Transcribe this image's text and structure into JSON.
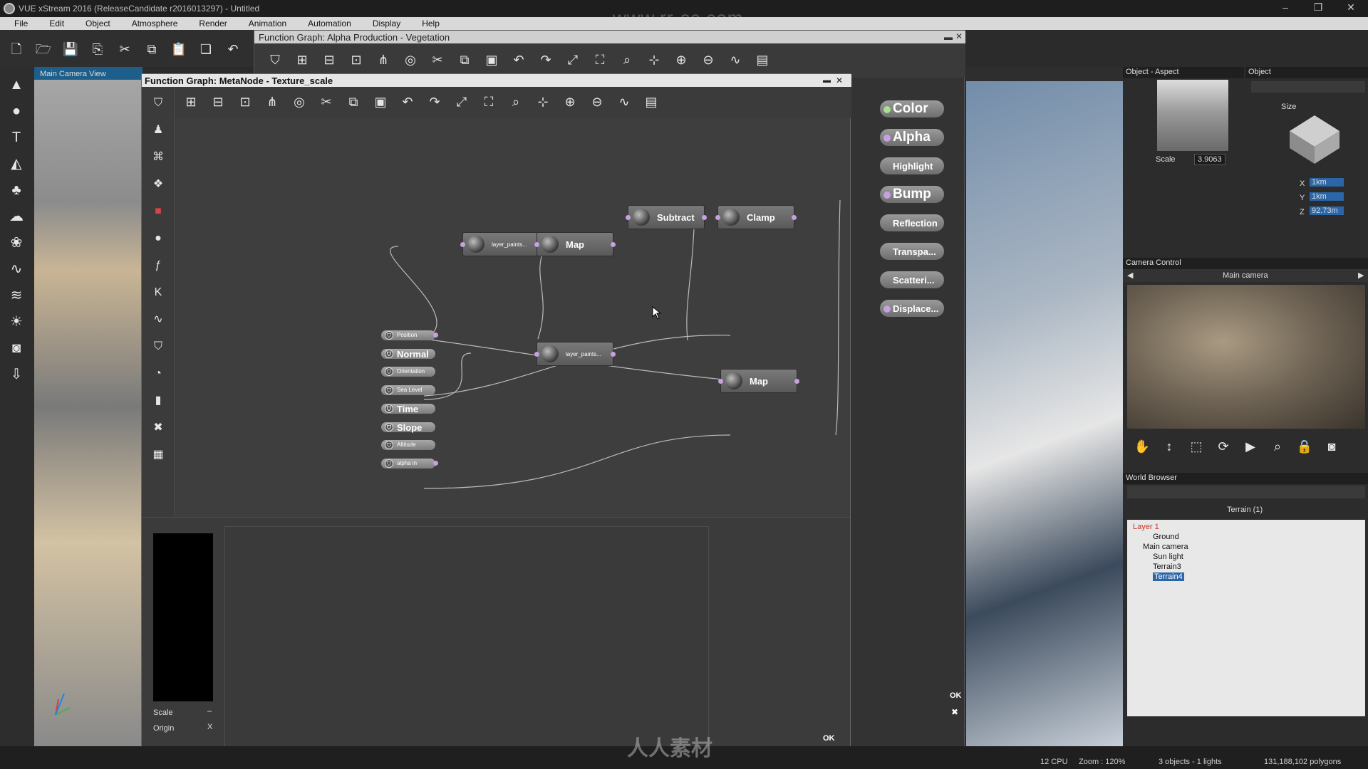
{
  "app": {
    "title": "VUE xStream 2016 (ReleaseCandidate r2016013297) - Untitled",
    "watermark_top": "www.rr-sc.com",
    "watermark_bottom": "人人素材",
    "window_buttons": [
      "–",
      "❐",
      "✕"
    ]
  },
  "menu": [
    "File",
    "Edit",
    "Object",
    "Atmosphere",
    "Render",
    "Animation",
    "Automation",
    "Display",
    "Help"
  ],
  "main_toolbar_icons": [
    "new-icon",
    "open-icon",
    "save-icon",
    "save-as-icon",
    "cut-icon",
    "copy-icon",
    "paste-icon",
    "duplicate-icon",
    "undo-icon"
  ],
  "left_tools_icons": [
    "terrain-icon",
    "sphere-icon",
    "text-icon",
    "rock-icon",
    "tree-icon",
    "cloud-icon",
    "plant-icon",
    "spline-icon",
    "water-icon",
    "light-icon",
    "camera-icon",
    "import-icon"
  ],
  "left_view": {
    "label": "Main Camera View"
  },
  "outer_graph": {
    "title": "Function Graph: Alpha Production - Vegetation",
    "outputs": [
      {
        "label": "Color",
        "big": true,
        "dot": "green"
      },
      {
        "label": "Alpha",
        "big": true,
        "dot": "purple"
      },
      {
        "label": "Highlight",
        "big": false,
        "dot": "none"
      },
      {
        "label": "Bump",
        "big": true,
        "dot": "purple"
      },
      {
        "label": "Reflection",
        "big": false,
        "dot": "none"
      },
      {
        "label": "Transpa...",
        "big": false,
        "dot": "none"
      },
      {
        "label": "Scatteri...",
        "big": false,
        "dot": "none"
      },
      {
        "label": "Displace...",
        "big": false,
        "dot": "purple"
      }
    ],
    "ok": "OK",
    "close": "✖"
  },
  "inner_graph": {
    "title": "Function Graph: MetaNode - Texture_scale",
    "inputs": [
      {
        "label": "Position",
        "big": false
      },
      {
        "label": "Normal",
        "big": true
      },
      {
        "label": "Orientation",
        "big": false
      },
      {
        "label": "Sea Level",
        "big": false
      },
      {
        "label": "Time",
        "big": true
      },
      {
        "label": "Slope",
        "big": true
      },
      {
        "label": "Altitude",
        "big": false
      },
      {
        "label": "alpha in",
        "big": false
      }
    ],
    "nodes": [
      {
        "id": "layer1",
        "label": "layer_paints...",
        "tiny": true
      },
      {
        "id": "map1",
        "label": "Map",
        "tiny": false
      },
      {
        "id": "subtract",
        "label": "Subtract",
        "tiny": false
      },
      {
        "id": "clamp",
        "label": "Clamp",
        "tiny": false
      },
      {
        "id": "layer2",
        "label": "layer_paints...",
        "tiny": true
      },
      {
        "id": "map2",
        "label": "Map",
        "tiny": false
      }
    ],
    "params": {
      "scale_label": "Scale",
      "scale_value": "–",
      "origin_label": "Origin",
      "origin_axis": "X"
    },
    "ok": "OK",
    "close": "✖"
  },
  "object_aspect": {
    "title": "Object - Aspect",
    "scale_label": "Scale",
    "scale_value": "3.9063"
  },
  "object_panel": {
    "title": "Object",
    "size_label": "Size",
    "x_label": "X",
    "x_value": "1km",
    "y_label": "Y",
    "y_value": "1km",
    "z_label": "Z",
    "z_value": "92.73m"
  },
  "camera_control": {
    "title": "Camera Control",
    "camera_name": "Main camera"
  },
  "world_browser": {
    "title": "World Browser",
    "subtitle": "Terrain (1)",
    "items": [
      {
        "label": "Layer 1",
        "indent": 0,
        "selected": false
      },
      {
        "label": "Ground",
        "indent": 2,
        "selected": false
      },
      {
        "label": "Main camera",
        "indent": 1,
        "selected": false
      },
      {
        "label": "Sun light",
        "indent": 2,
        "selected": false
      },
      {
        "label": "Terrain3",
        "indent": 2,
        "selected": false
      },
      {
        "label": "Terrain4",
        "indent": 2,
        "selected": true
      }
    ]
  },
  "status": {
    "cpu": "12 CPU",
    "zoom": "Zoom : 120%",
    "objects": "3 objects - 1 lights",
    "polygons": "131,188,102 polygons"
  }
}
